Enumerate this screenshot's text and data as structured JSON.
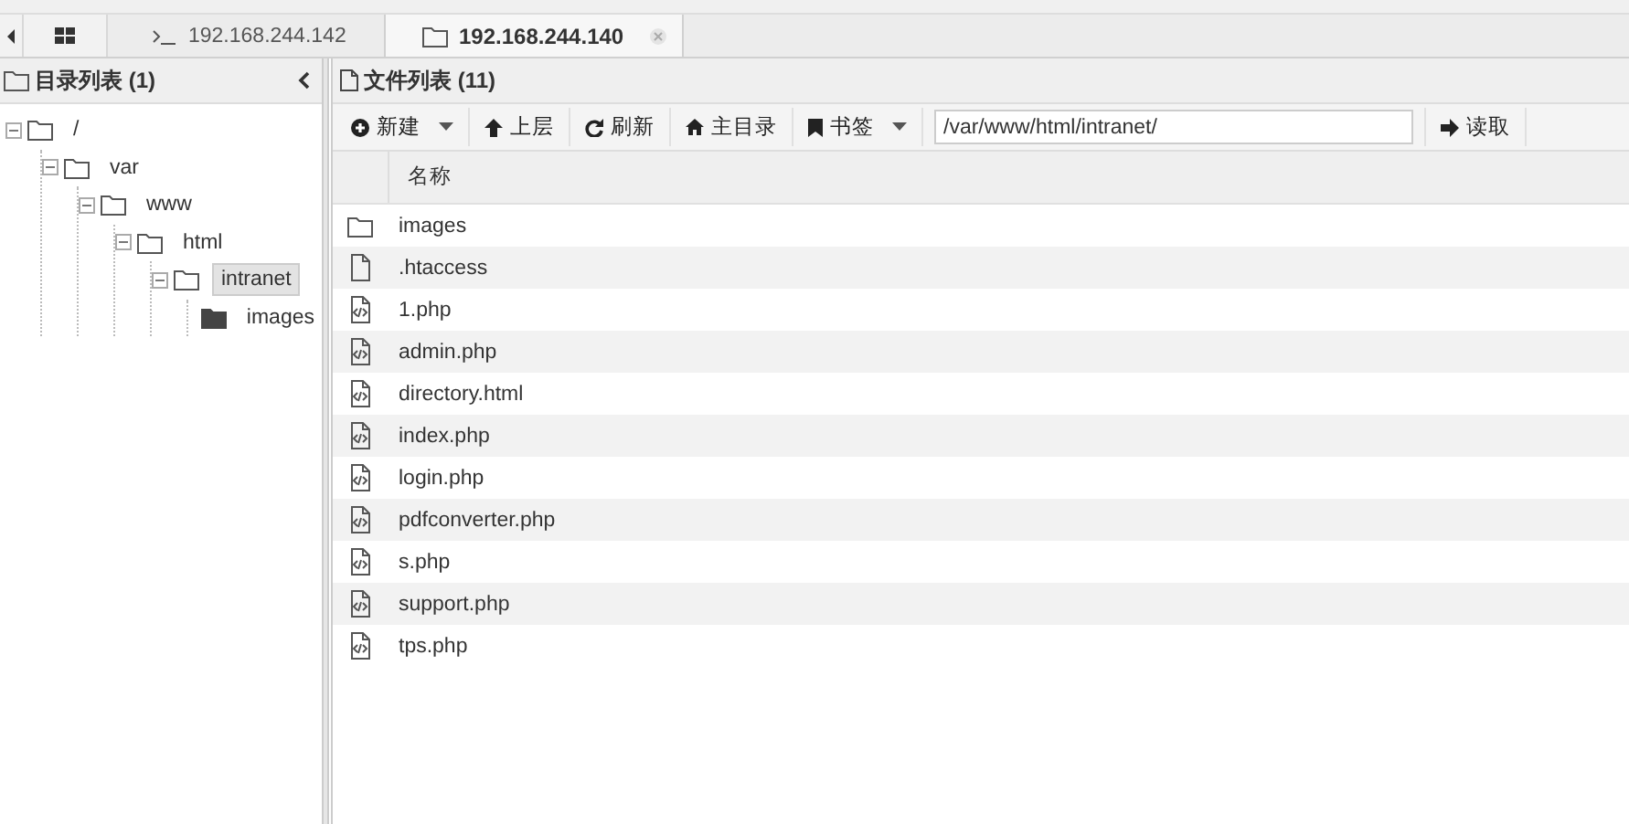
{
  "tabs": [
    {
      "label": "192.168.244.142",
      "kind": "terminal",
      "selected": false
    },
    {
      "label": "192.168.244.140",
      "kind": "folder",
      "selected": true
    }
  ],
  "directory_panel": {
    "title": "目录列表 (1)",
    "tree": [
      {
        "label": "/",
        "expanded": true,
        "selected": false,
        "children": [
          {
            "label": "var",
            "expanded": true,
            "selected": false,
            "children": [
              {
                "label": "www",
                "expanded": true,
                "selected": false,
                "children": [
                  {
                    "label": "html",
                    "expanded": true,
                    "selected": false,
                    "children": [
                      {
                        "label": "intranet",
                        "expanded": true,
                        "selected": true,
                        "children": [
                          {
                            "label": "images",
                            "expanded": false,
                            "selected": false
                          }
                        ]
                      }
                    ]
                  }
                ]
              }
            ]
          }
        ]
      }
    ]
  },
  "file_panel": {
    "title": "文件列表 (11)",
    "toolbar": [
      {
        "label": "新建",
        "has_menu": true
      },
      {
        "label": "上层",
        "has_menu": false
      },
      {
        "label": "刷新",
        "has_menu": false
      },
      {
        "label": "主目录",
        "has_menu": false
      },
      {
        "label": "书签",
        "has_menu": true
      }
    ],
    "path": "/var/www/html/intranet/",
    "read_button": "读取",
    "column": "名称",
    "files": [
      {
        "name": "images",
        "kind": "folder"
      },
      {
        "name": ".htaccess",
        "kind": "file"
      },
      {
        "name": "1.php",
        "kind": "script"
      },
      {
        "name": "admin.php",
        "kind": "script"
      },
      {
        "name": "directory.html",
        "kind": "script"
      },
      {
        "name": "index.php",
        "kind": "script"
      },
      {
        "name": "login.php",
        "kind": "script"
      },
      {
        "name": "pdfconverter.php",
        "kind": "script"
      },
      {
        "name": "s.php",
        "kind": "script"
      },
      {
        "name": "support.php",
        "kind": "script"
      },
      {
        "name": "tps.php",
        "kind": "script"
      }
    ]
  }
}
